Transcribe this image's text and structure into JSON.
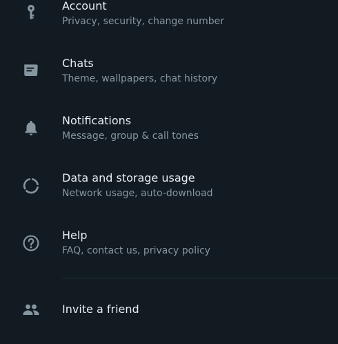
{
  "settings": {
    "items": [
      {
        "title": "Account",
        "subtitle": "Privacy, security, change number",
        "icon": "key-icon"
      },
      {
        "title": "Chats",
        "subtitle": "Theme, wallpapers, chat history",
        "icon": "chat-icon"
      },
      {
        "title": "Notifications",
        "subtitle": "Message, group & call tones",
        "icon": "bell-icon"
      },
      {
        "title": "Data and storage usage",
        "subtitle": "Network usage, auto-download",
        "icon": "data-usage-icon"
      },
      {
        "title": "Help",
        "subtitle": "FAQ, contact us, privacy policy",
        "icon": "help-icon"
      }
    ],
    "invite": {
      "title": "Invite a friend",
      "icon": "people-icon"
    }
  },
  "colors": {
    "background": "#121b22",
    "primary_text": "#e9edef",
    "secondary_text": "#8696a0",
    "icon": "#8696a0",
    "divider": "#222d34"
  }
}
